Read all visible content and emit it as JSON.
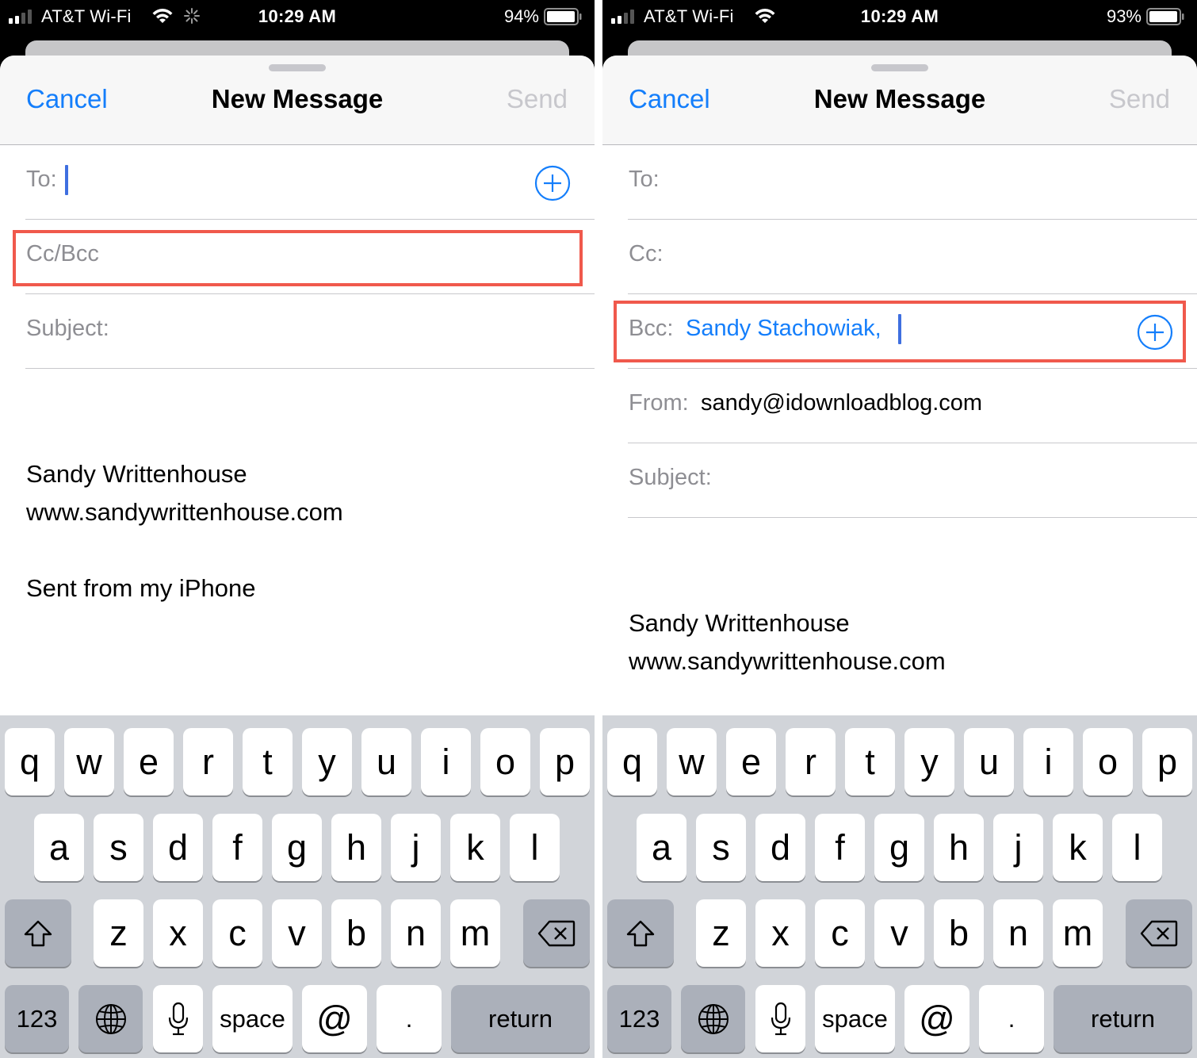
{
  "screens": [
    {
      "status": {
        "carrier": "AT&T Wi-Fi",
        "time": "10:29 AM",
        "battery_pct": "94%",
        "activity_spinner": true
      },
      "nav": {
        "cancel": "Cancel",
        "title": "New Message",
        "send": "Send"
      },
      "fields": {
        "to_label": "To:",
        "ccbcc_label": "Cc/Bcc",
        "subject_label": "Subject:"
      },
      "body": {
        "signature_name": "Sandy Writtenhouse",
        "signature_url": "www.sandywrittenhouse.com",
        "sent_from": "Sent from my iPhone"
      },
      "highlight": "Cc/Bcc field"
    },
    {
      "status": {
        "carrier": "AT&T Wi-Fi",
        "time": "10:29 AM",
        "battery_pct": "93%",
        "activity_spinner": false
      },
      "nav": {
        "cancel": "Cancel",
        "title": "New Message",
        "send": "Send"
      },
      "fields": {
        "to_label": "To:",
        "cc_label": "Cc:",
        "bcc_label": "Bcc:",
        "bcc_value": "Sandy Stachowiak,",
        "from_label": "From:",
        "from_value": "sandy@idownloadblog.com",
        "subject_label": "Subject:"
      },
      "body": {
        "signature_name": "Sandy Writtenhouse",
        "signature_url": "www.sandywrittenhouse.com"
      },
      "highlight": "Bcc field"
    }
  ],
  "keyboard": {
    "row1": [
      "q",
      "w",
      "e",
      "r",
      "t",
      "y",
      "u",
      "i",
      "o",
      "p"
    ],
    "row2": [
      "a",
      "s",
      "d",
      "f",
      "g",
      "h",
      "j",
      "k",
      "l"
    ],
    "row3": [
      "z",
      "x",
      "c",
      "v",
      "b",
      "n",
      "m"
    ],
    "numbers": "123",
    "space": "space",
    "at": "@",
    "period": ".",
    "return": "return",
    "icons": {
      "shift": "shift-icon",
      "delete": "delete-icon",
      "globe": "globe-icon",
      "mic": "microphone-icon"
    }
  },
  "colors": {
    "accent": "#147efb",
    "highlight": "#f0594c",
    "disabled": "#c7c7cc",
    "label": "#8e8e93",
    "keyboard_bg": "#d1d4d9"
  }
}
